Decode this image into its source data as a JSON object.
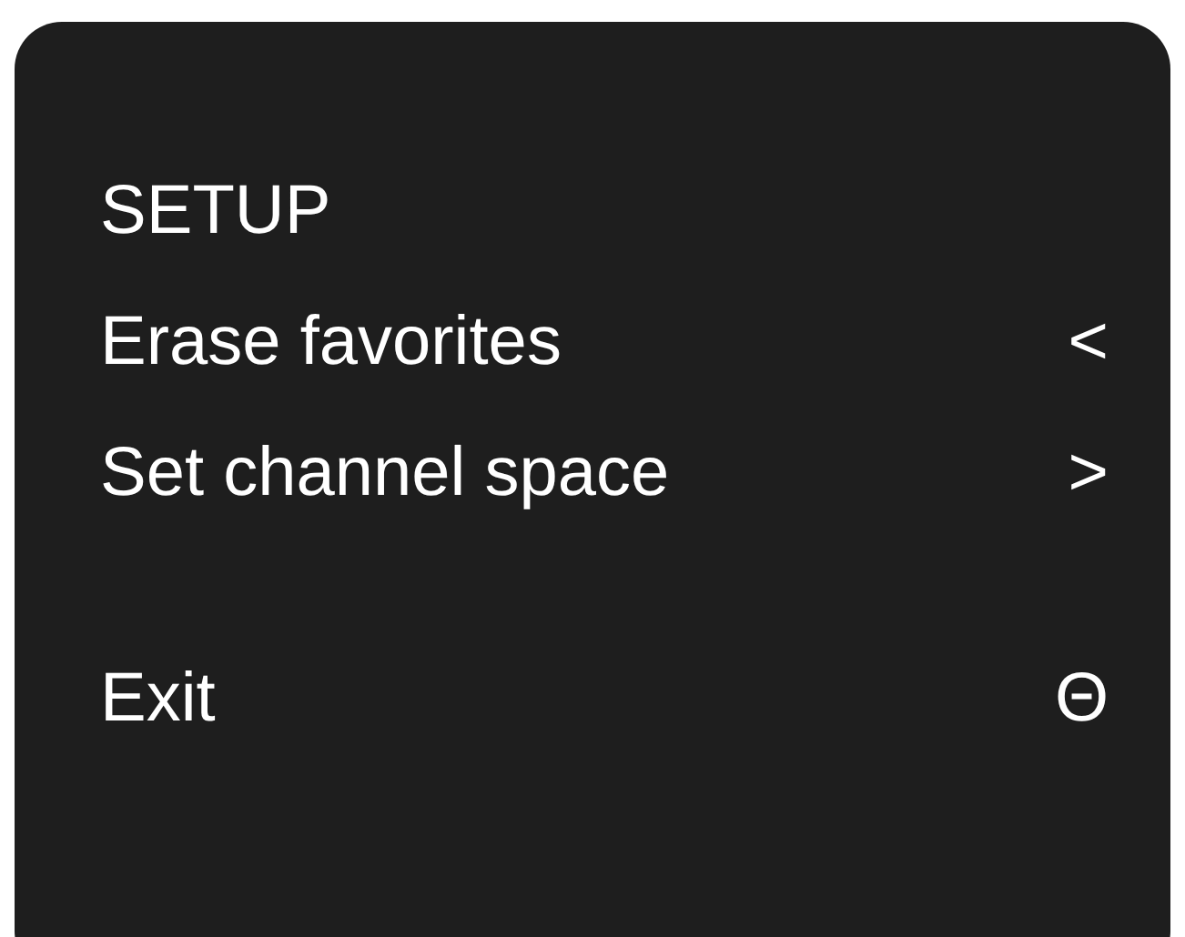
{
  "title": "SETUP",
  "items": [
    {
      "label": "Erase favorites",
      "key": "<"
    },
    {
      "label": "Set channel space",
      "key": ">"
    }
  ],
  "exit": {
    "label": "Exit",
    "key": "Θ"
  }
}
